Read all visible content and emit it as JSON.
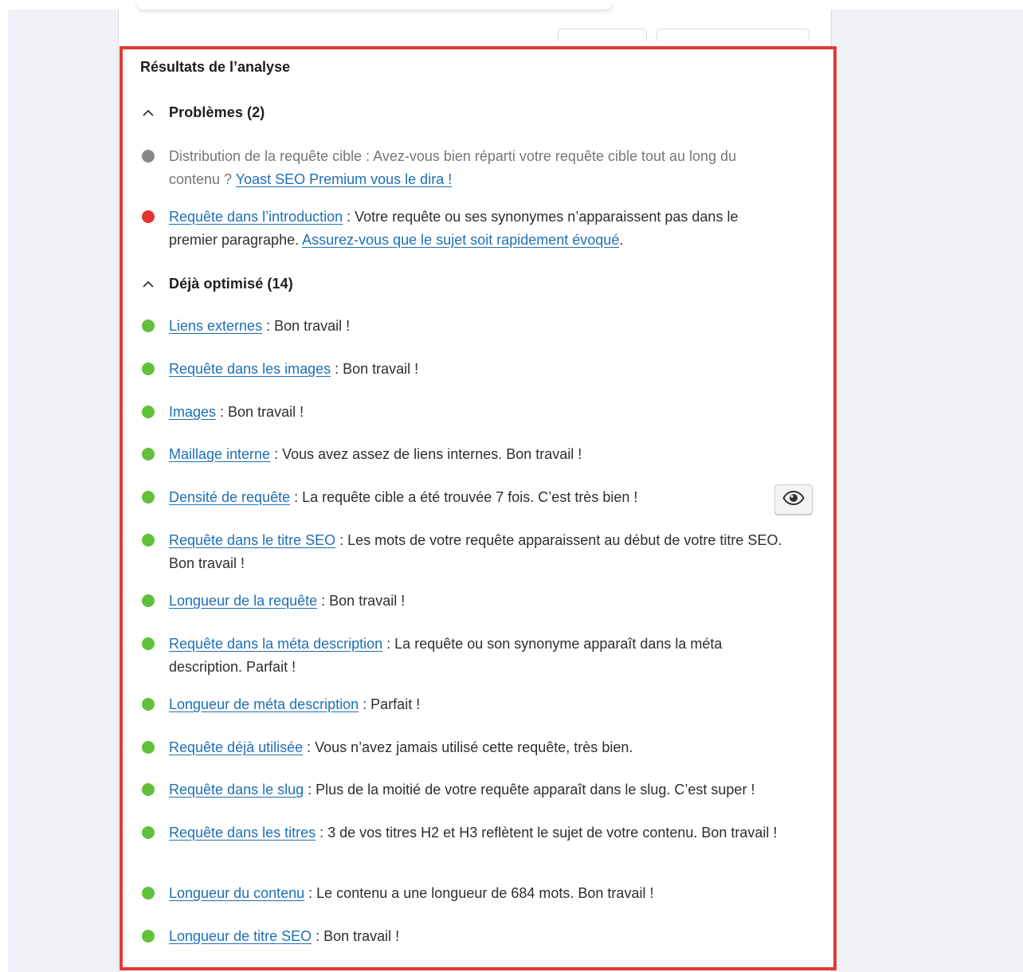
{
  "colors": {
    "problem_red": "#e3342f",
    "good_green": "#61c13b",
    "na_grey": "#888888",
    "highlight_border": "#e03a35",
    "link_blue": "#1f6fb4"
  },
  "panel": {
    "title": "Résultats de l’analyse"
  },
  "problems": {
    "heading": "Problèmes (2)",
    "icon": "chevron-up-icon",
    "items": [
      {
        "status": "grey",
        "link": "",
        "text": "Distribution de la requête cible : Avez-vous bien réparti votre requête cible tout au long du contenu ? ",
        "cta": "Yoast SEO Premium vous le dira !",
        "tail": ""
      },
      {
        "status": "red",
        "link": "Requête dans l’introduction",
        "text": " : Votre requête ou ses synonymes n’apparaissent pas dans le premier paragraphe. ",
        "cta": "Assurez-vous que le sujet soit rapidement évoqué",
        "tail": "."
      }
    ]
  },
  "optimized": {
    "heading": "Déjà optimisé (14)",
    "icon": "chevron-up-icon",
    "items": [
      {
        "link": "Liens externes",
        "text": " : Bon travail !"
      },
      {
        "link": "Requête dans les images",
        "text": " : Bon travail !"
      },
      {
        "link": "Images",
        "text": " : Bon travail !"
      },
      {
        "link": "Maillage interne",
        "text": " : Vous avez assez de liens internes. Bon travail !"
      },
      {
        "link": "Densité de requête",
        "text": " : La requête cible a été trouvée 7 fois. C’est très bien !"
      },
      {
        "link": "Requête dans le titre SEO",
        "text": " : Les mots de votre requête apparaissent au début de votre titre SEO. Bon travail !"
      },
      {
        "link": "Longueur de la requête",
        "text": " : Bon travail !"
      },
      {
        "link": "Requête dans la méta description",
        "text": " : La requête ou son synonyme apparaît dans la méta description. Parfait !"
      },
      {
        "link": "Longueur de méta description",
        "text": " : Parfait !"
      },
      {
        "link": "Requête déjà utilisée",
        "text": " : Vous n’avez jamais utilisé cette requête, très bien."
      },
      {
        "link": "Requête dans le slug",
        "text": " : Plus de la moitié de votre requête apparaît dans le slug. C’est super !"
      },
      {
        "link": "Requête dans les titres",
        "text": " : 3 de vos titres H2 et H3 reflètent le sujet de votre contenu. Bon travail !"
      },
      {
        "link": "Longueur du contenu",
        "text": " : Le contenu a une longueur de 684 mots. Bon travail !"
      },
      {
        "link": "Longueur de titre SEO",
        "text": " : Bon travail !"
      }
    ]
  },
  "eye_button": {
    "icon": "eye-icon"
  }
}
